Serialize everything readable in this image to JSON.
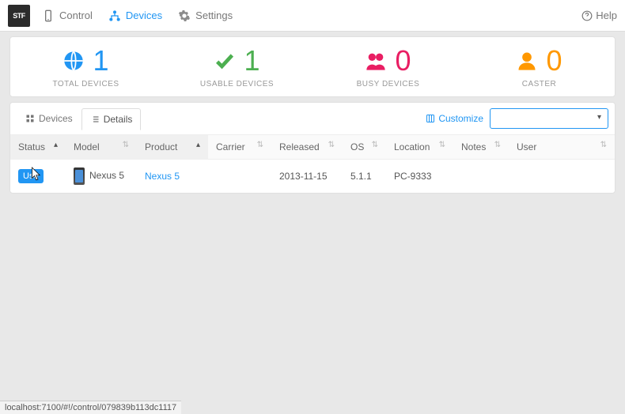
{
  "nav": {
    "control": "Control",
    "devices": "Devices",
    "settings": "Settings",
    "help": "Help"
  },
  "stats": {
    "total": {
      "value": "1",
      "label": "TOTAL DEVICES",
      "color": "#2196f3"
    },
    "usable": {
      "value": "1",
      "label": "USABLE DEVICES",
      "color": "#4caf50"
    },
    "busy": {
      "value": "0",
      "label": "BUSY DEVICES",
      "color": "#e91e63"
    },
    "caster": {
      "value": "0",
      "label": "CASTER",
      "color": "#ff9800"
    }
  },
  "viewTabs": {
    "devices": "Devices",
    "details": "Details"
  },
  "toolbar": {
    "customize": "Customize"
  },
  "columns": {
    "status": "Status",
    "model": "Model",
    "product": "Product",
    "carrier": "Carrier",
    "released": "Released",
    "os": "OS",
    "location": "Location",
    "notes": "Notes",
    "user": "User"
  },
  "row": {
    "useBtn": "Use",
    "model": "Nexus 5",
    "product": "Nexus 5",
    "carrier": "",
    "released": "2013-11-15",
    "os": "5.1.1",
    "location": "PC-9333",
    "notes": "",
    "user": ""
  },
  "statusbar": "localhost:7100/#!/control/079839b113dc1117"
}
